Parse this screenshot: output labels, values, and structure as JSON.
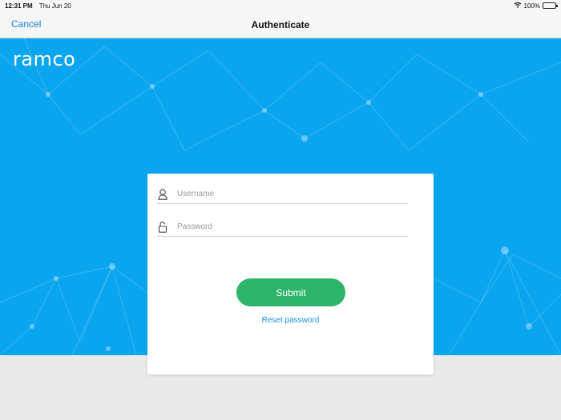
{
  "status_bar": {
    "time": "12:31 PM",
    "date": "Thu Jun 20",
    "battery": "100%"
  },
  "nav": {
    "cancel_label": "Cancel",
    "title": "Authenticate"
  },
  "brand": {
    "logo_text": "ramco"
  },
  "login_form": {
    "username_placeholder": "Username",
    "password_placeholder": "Password",
    "submit_label": "Submit",
    "reset_password_label": "Reset password"
  },
  "colors": {
    "hero_background": "#0aa5ef",
    "submit_button": "#2db56c",
    "link_blue": "#1a7ee6",
    "page_background": "#e9e9ea"
  },
  "icons": [
    "wifi-icon",
    "battery-icon",
    "user-icon",
    "lock-icon"
  ]
}
